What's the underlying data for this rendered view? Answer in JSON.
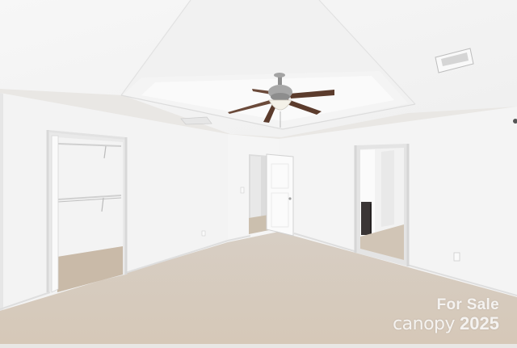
{
  "photo": {
    "subject": "empty carpeted bedroom with tray ceiling, ceiling fan, open walk-in closet and open doorways"
  },
  "watermark": {
    "line1": "For Sale",
    "brand": "canopy",
    "year": "2025"
  },
  "colors": {
    "wall": "#f3f3f3",
    "ceiling": "#f6f6f6",
    "carpet": "#d9cdbf",
    "fan_blade": "#5b3b2c",
    "fan_metal": "#9c9c9c"
  }
}
